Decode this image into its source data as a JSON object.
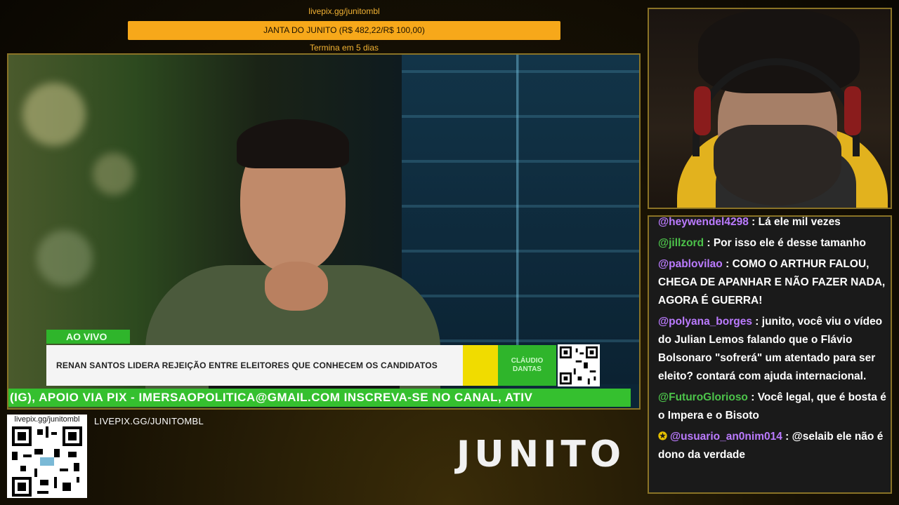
{
  "goal": {
    "url": "livepix.gg/junitombl",
    "label": "JANTA DO JUNITO (R$ 482,22/R$ 100,00)",
    "progress": 1.0,
    "subtext": "Termina em 5 dias",
    "color": "#f7a81a"
  },
  "broadcast": {
    "live_label": "AO VIVO",
    "headline": "RENAN SANTOS LIDERA REJEIÇÃO ENTRE ELEITORES QUE CONHECEM OS CANDIDATOS",
    "anchor_name": "CLÁUDIO DANTAS",
    "ticker": "(IG), APOIO VIA PIX - IMERSAOPOLITICA@GMAIL.COM                       INSCREVA-SE NO CANAL, ATIV",
    "accent_color": "#35c02f"
  },
  "chat": {
    "messages": [
      {
        "user": "@heywendel4298",
        "text": "Lá ele mil vezes",
        "color": "purple"
      },
      {
        "user": "@jillzord",
        "text": "Por isso ele é desse tamanho",
        "color": "green"
      },
      {
        "user": "@pablovilao",
        "text": "COMO O ARTHUR FALOU, CHEGA DE APANHAR E NÃO FAZER NADA, AGORA É GUERRA!",
        "color": "purple"
      },
      {
        "user": "@polyana_borges",
        "text": "junito, você viu o vídeo do Julian Lemos falando que o Flávio Bolsonaro \"sofrerá\" um atentado para ser eleito? contará com ajuda internacional.",
        "color": "purple"
      },
      {
        "user": "@FuturoGlorioso",
        "text": "Você legal, que é bosta é o Impera e o Bisoto",
        "color": "green"
      },
      {
        "user": "@usuario_an0nim014",
        "text": "@selaib ele não é dono da verdade",
        "color": "purple",
        "badge": "✪"
      }
    ]
  },
  "qr": {
    "url": "livepix.gg/junitombl"
  },
  "livepix_label": "LIVEPIX.GG/JUNITOMBL",
  "logo": "JUNITO"
}
